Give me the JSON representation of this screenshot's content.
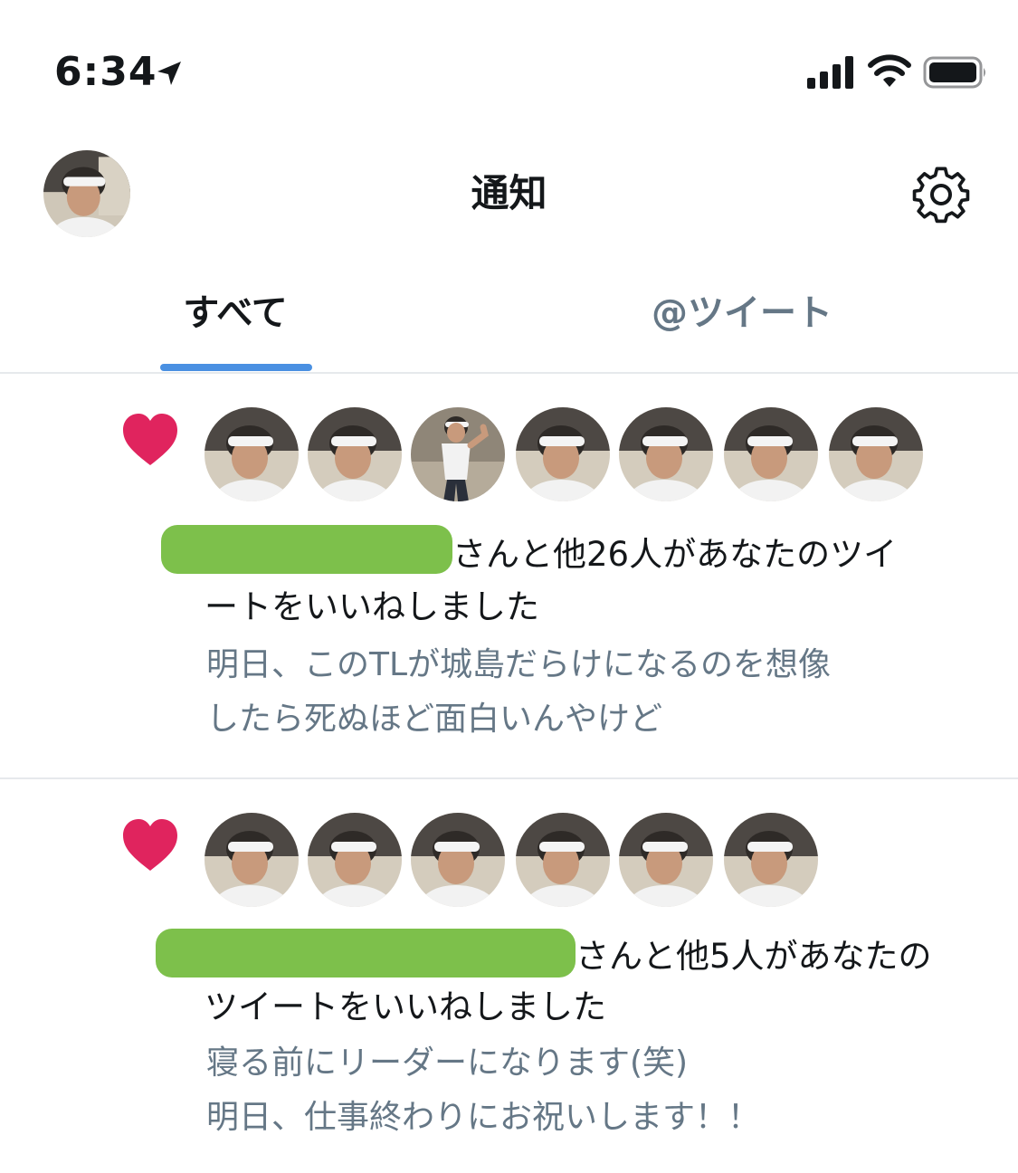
{
  "status_bar": {
    "time": "6:34",
    "icons": [
      "location-arrow-icon",
      "signal-icon",
      "wifi-icon",
      "battery-icon"
    ]
  },
  "header": {
    "title": "通知",
    "settings_icon": "gear-icon"
  },
  "tabs": [
    {
      "label": "すべて",
      "active": true
    },
    {
      "label": "@ツイート",
      "active": false
    }
  ],
  "colors": {
    "accent": "#4a90e2",
    "like": "#e0245e",
    "secondary_text": "#657786",
    "redaction": "#7dc04b"
  },
  "notifications": [
    {
      "icon": "heart-icon",
      "avatar_count": 7,
      "line1": "さんと他26人があなたのツイ",
      "line2": "ートをいいねしました",
      "preview_lines": [
        "明日、このTLが城島だらけになるのを想像",
        "したら死ぬほど面白いんやけど"
      ]
    },
    {
      "icon": "heart-icon",
      "avatar_count": 6,
      "line1": "さんと他5人があなたの",
      "line2": "ツイートをいいねしました",
      "preview_lines": [
        "寝る前にリーダーになります(笑)",
        "明日、仕事終わりにお祝いします！！"
      ]
    }
  ]
}
